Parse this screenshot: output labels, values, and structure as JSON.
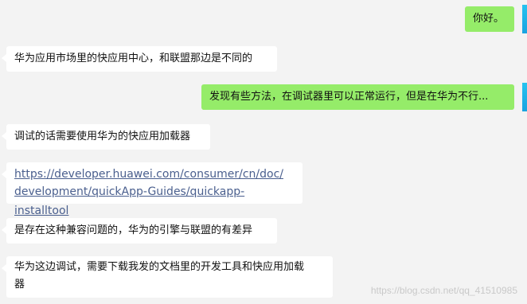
{
  "messages": [
    {
      "side": "right",
      "text": "你好。"
    },
    {
      "side": "left",
      "text": "华为应用市场里的快应用中心，和联盟那边是不同的"
    },
    {
      "side": "right",
      "text": "发现有些方法，在调试器里可以正常运行，但是在华为不行..."
    },
    {
      "side": "left",
      "text": "调试的话需要使用华为的快应用加载器"
    },
    {
      "side": "left",
      "link_line1": "https://developer.huawei.com/consumer/cn/doc/",
      "link_line2": "development/quickApp-Guides/quickapp-installtool"
    },
    {
      "side": "left",
      "text": "是存在这种兼容问题的，华为的引擎与联盟的有差异"
    },
    {
      "side": "left",
      "line1": "华为这边调试，需要下载我发的文档里的开发工具和快应用加载",
      "line2": "器"
    }
  ],
  "watermark": "https://blog.csdn.net/qq_41510985",
  "colors": {
    "self_bubble": "#95ec69",
    "other_bubble": "#ffffff",
    "background": "#f3f3f3",
    "link": "#4a5f8e"
  }
}
